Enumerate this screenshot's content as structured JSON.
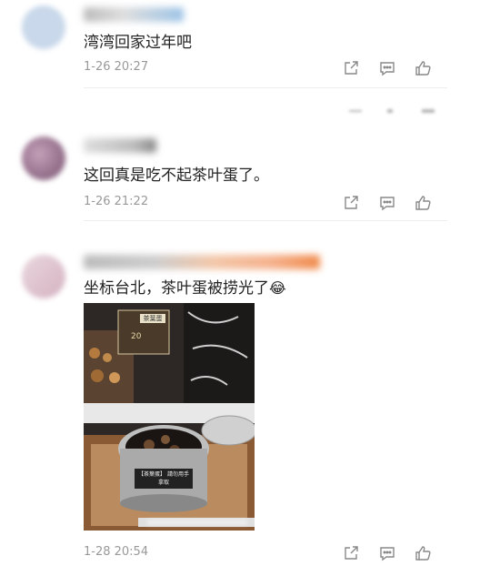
{
  "comments": [
    {
      "text": "湾湾回家过年吧",
      "time": "1-26 20:27"
    },
    {
      "text": "这回真是吃不起茶叶蛋了。",
      "time": "1-26 21:22"
    },
    {
      "text": "坐标台北，茶叶蛋被捞光了",
      "emoji": "😂",
      "time": "1-28 20:54",
      "photo": {
        "sign_text": "茶葉蛋",
        "price_text": "20",
        "cooker_label": "【茶葉蛋】 請勿用手拿取"
      }
    }
  ],
  "icons": {
    "share": "share-icon",
    "comment": "comment-icon",
    "like": "thumbs-up-icon"
  },
  "colors": {
    "text": "#222222",
    "time": "#999999",
    "icon": "#888888",
    "divider": "#eeeeee"
  }
}
